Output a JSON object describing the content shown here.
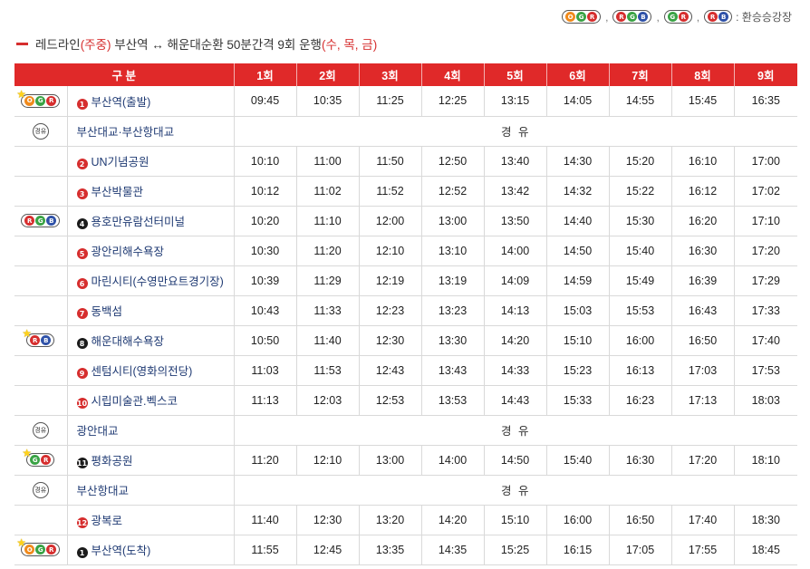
{
  "legend": {
    "groups": [
      {
        "name": "ogr",
        "dots": [
          "O",
          "G",
          "R"
        ]
      },
      {
        "name": "rgb",
        "dots": [
          "R",
          "G",
          "B"
        ]
      },
      {
        "name": "gr",
        "dots": [
          "G",
          "R"
        ]
      },
      {
        "name": "rb",
        "dots": [
          "R",
          "B"
        ]
      }
    ],
    "separator": ",",
    "note": ": 환승승강장"
  },
  "title": {
    "line": "레드라인",
    "line_paren": "(주중)",
    "route": " 부산역 ↔ 해운대순환 50분간격 9회 운행",
    "days": "(수, 목, 금)"
  },
  "table": {
    "headers": [
      "구 분",
      "1회",
      "2회",
      "3회",
      "4회",
      "5회",
      "6회",
      "7회",
      "8회",
      "9회"
    ],
    "via_label": "경 유",
    "via_icon_text": "경유",
    "rows": [
      {
        "type": "stop",
        "badge": [
          "O",
          "G",
          "R"
        ],
        "star": true,
        "num": "1",
        "num_style": "red",
        "name": "부산역(출발)",
        "times": [
          "09:45",
          "10:35",
          "11:25",
          "12:25",
          "13:15",
          "14:05",
          "14:55",
          "15:45",
          "16:35"
        ]
      },
      {
        "type": "via",
        "name": "부산대교·부산항대교"
      },
      {
        "type": "stop",
        "badge": null,
        "num": "2",
        "num_style": "red",
        "name": "UN기념공원",
        "times": [
          "10:10",
          "11:00",
          "11:50",
          "12:50",
          "13:40",
          "14:30",
          "15:20",
          "16:10",
          "17:00"
        ]
      },
      {
        "type": "stop",
        "badge": null,
        "num": "3",
        "num_style": "red",
        "name": "부산박물관",
        "times": [
          "10:12",
          "11:02",
          "11:52",
          "12:52",
          "13:42",
          "14:32",
          "15:22",
          "16:12",
          "17:02"
        ]
      },
      {
        "type": "stop",
        "badge": [
          "R",
          "G",
          "B"
        ],
        "star": false,
        "num": "4",
        "num_style": "black",
        "name": "용호만유람선터미널",
        "times": [
          "10:20",
          "11:10",
          "12:00",
          "13:00",
          "13:50",
          "14:40",
          "15:30",
          "16:20",
          "17:10"
        ]
      },
      {
        "type": "stop",
        "badge": null,
        "num": "5",
        "num_style": "red",
        "name": "광안리해수욕장",
        "times": [
          "10:30",
          "11:20",
          "12:10",
          "13:10",
          "14:00",
          "14:50",
          "15:40",
          "16:30",
          "17:20"
        ]
      },
      {
        "type": "stop",
        "badge": null,
        "num": "6",
        "num_style": "red",
        "name": "마린시티(수영만요트경기장)",
        "times": [
          "10:39",
          "11:29",
          "12:19",
          "13:19",
          "14:09",
          "14:59",
          "15:49",
          "16:39",
          "17:29"
        ]
      },
      {
        "type": "stop",
        "badge": null,
        "num": "7",
        "num_style": "red",
        "name": "동백섬",
        "times": [
          "10:43",
          "11:33",
          "12:23",
          "13:23",
          "14:13",
          "15:03",
          "15:53",
          "16:43",
          "17:33"
        ]
      },
      {
        "type": "stop",
        "badge": [
          "R",
          "B"
        ],
        "star": true,
        "num": "8",
        "num_style": "black",
        "name": "해운대해수욕장",
        "times": [
          "10:50",
          "11:40",
          "12:30",
          "13:30",
          "14:20",
          "15:10",
          "16:00",
          "16:50",
          "17:40"
        ]
      },
      {
        "type": "stop",
        "badge": null,
        "num": "9",
        "num_style": "red",
        "name": "센텀시티(영화의전당)",
        "times": [
          "11:03",
          "11:53",
          "12:43",
          "13:43",
          "14:33",
          "15:23",
          "16:13",
          "17:03",
          "17:53"
        ]
      },
      {
        "type": "stop",
        "badge": null,
        "num": "10",
        "num_style": "red",
        "name": "시립미술관.벡스코",
        "times": [
          "11:13",
          "12:03",
          "12:53",
          "13:53",
          "14:43",
          "15:33",
          "16:23",
          "17:13",
          "18:03"
        ]
      },
      {
        "type": "via",
        "name": "광안대교"
      },
      {
        "type": "stop",
        "badge": [
          "G",
          "R"
        ],
        "star": true,
        "num": "11",
        "num_style": "black",
        "name": "평화공원",
        "times": [
          "11:20",
          "12:10",
          "13:00",
          "14:00",
          "14:50",
          "15:40",
          "16:30",
          "17:20",
          "18:10"
        ]
      },
      {
        "type": "via",
        "name": "부산항대교"
      },
      {
        "type": "stop",
        "badge": null,
        "num": "12",
        "num_style": "red",
        "name": "광복로",
        "times": [
          "11:40",
          "12:30",
          "13:20",
          "14:20",
          "15:10",
          "16:00",
          "16:50",
          "17:40",
          "18:30"
        ]
      },
      {
        "type": "stop",
        "badge": [
          "O",
          "G",
          "R"
        ],
        "star": true,
        "num": "1",
        "num_style": "black",
        "name": "부산역(도착)",
        "times": [
          "11:55",
          "12:45",
          "13:35",
          "14:35",
          "15:25",
          "16:15",
          "17:05",
          "17:55",
          "18:45"
        ]
      }
    ]
  },
  "colors": {
    "header_red": "#e02929",
    "line_red": "#d62e2e",
    "orange": "#f08a1c",
    "green": "#3aa345",
    "blue": "#2f52a8",
    "stop_text": "#1f3a73"
  }
}
